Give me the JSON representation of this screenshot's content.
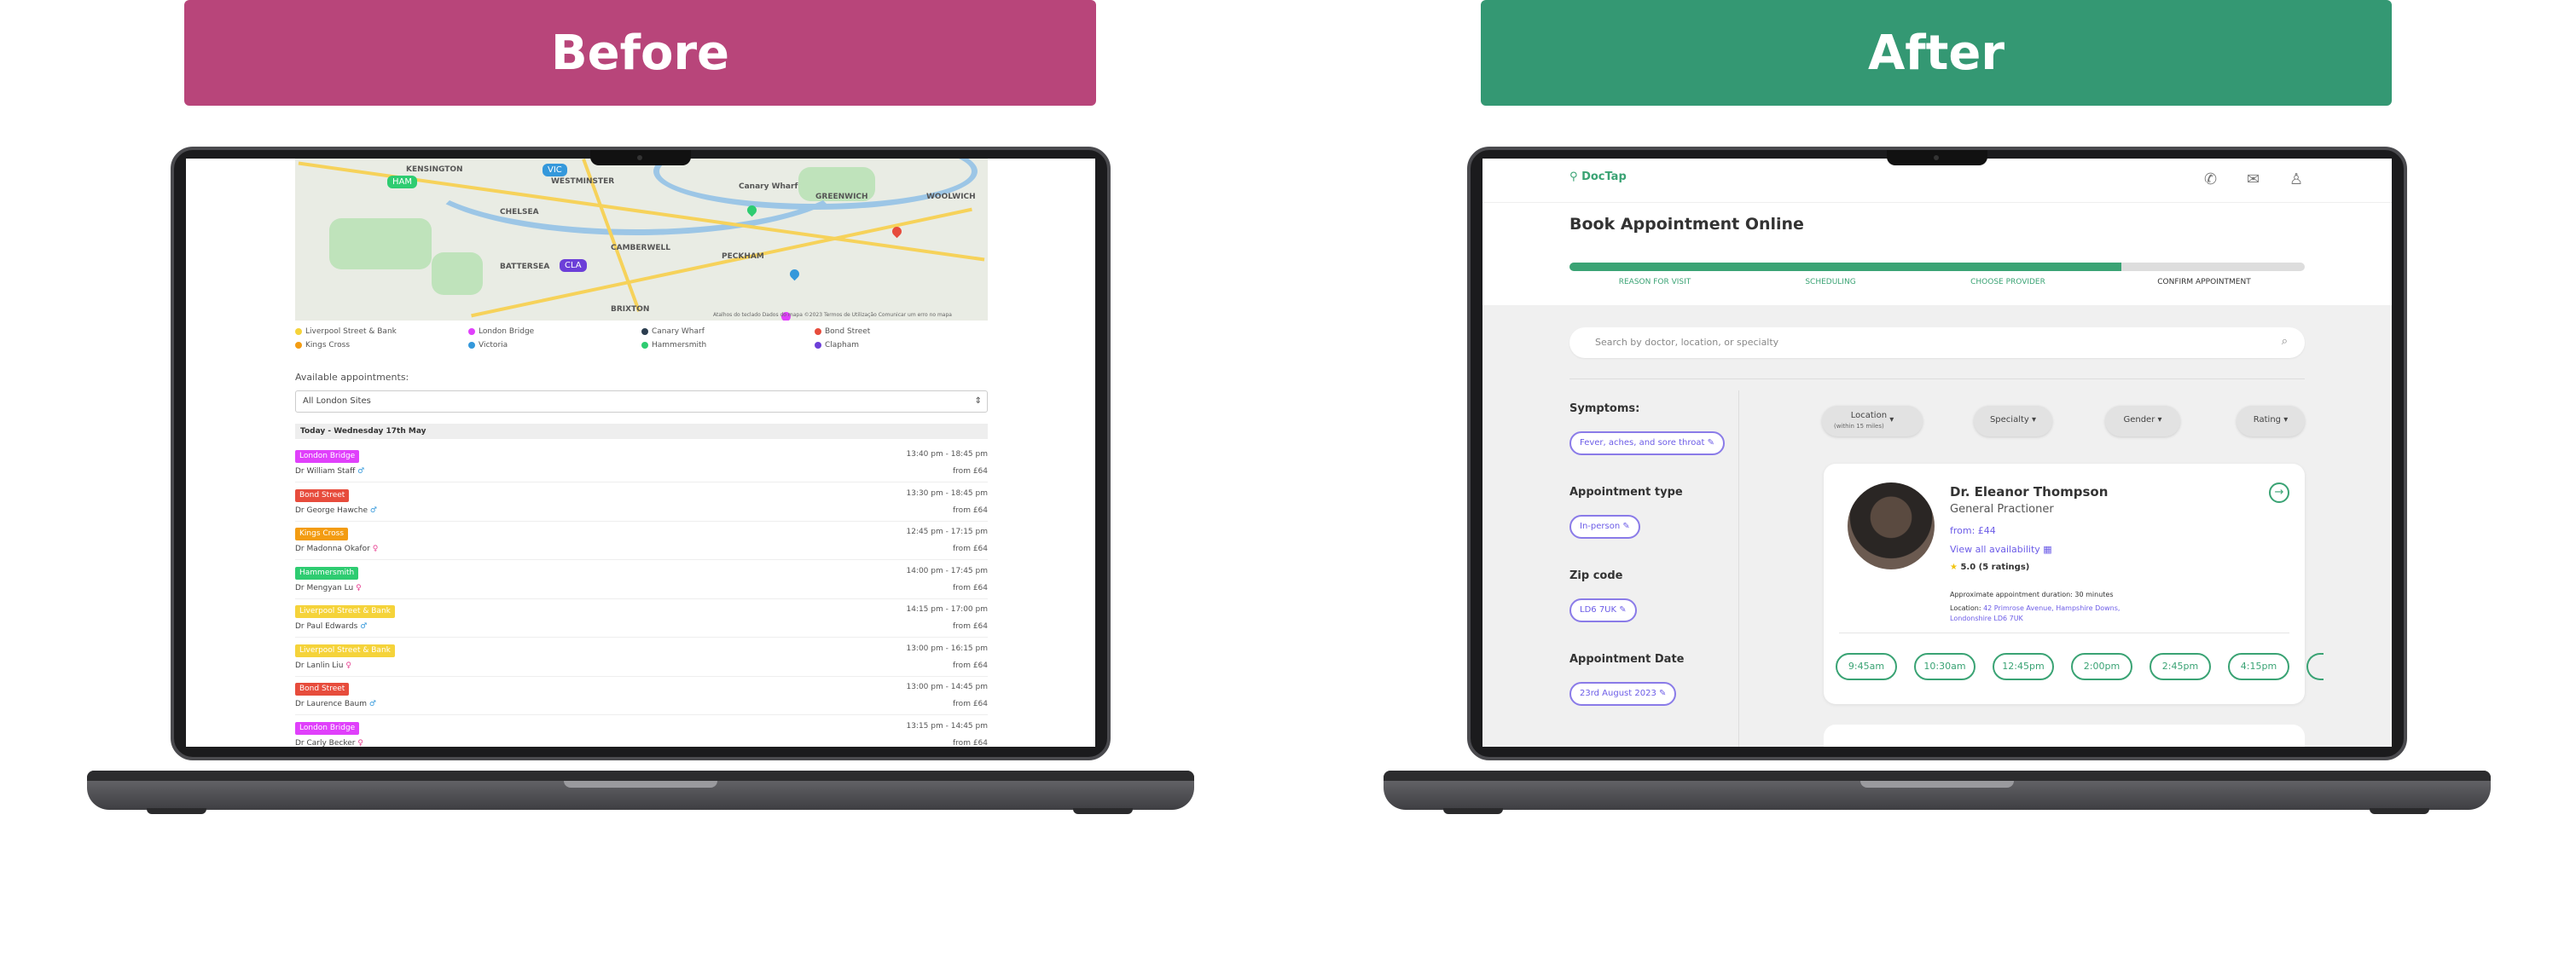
{
  "banners": {
    "before": "Before",
    "after": "After",
    "before_color": "#b8457a",
    "after_color": "#349873"
  },
  "before": {
    "map_labels": [
      "KENSINGTON",
      "WESTMINSTER",
      "CHELSEA",
      "BATTERSEA",
      "CAMBERWELL",
      "PECKHAM",
      "GREENWICH",
      "BRIXTON",
      "WOOLWICH",
      "Canary Wharf"
    ],
    "map_tags": [
      {
        "text": "HAM",
        "color": "#2ecc71"
      },
      {
        "text": "VIC",
        "color": "#3498db"
      },
      {
        "text": "CLA",
        "color": "#6c3fd8"
      }
    ],
    "map_footer": "Atalhos do teclado   Dados do mapa ©2023   Termos de Utilização   Comunicar um erro no mapa",
    "legend": [
      {
        "label": "Liverpool Street & Bank",
        "color": "#f5d33a"
      },
      {
        "label": "London Bridge",
        "color": "#e040fb"
      },
      {
        "label": "Canary Wharf",
        "color": "#2c3e50"
      },
      {
        "label": "Bond Street",
        "color": "#e74c3c"
      },
      {
        "label": "Kings Cross",
        "color": "#f39c12"
      },
      {
        "label": "Victoria",
        "color": "#3498db"
      },
      {
        "label": "Hammersmith",
        "color": "#2ecc71"
      },
      {
        "label": "Clapham",
        "color": "#6c3fd8"
      }
    ],
    "available_label": "Available appointments:",
    "select_value": "All London Sites",
    "day_header": "Today - Wednesday 17th May",
    "appointments": [
      {
        "site": "London Bridge",
        "color": "#e040fb",
        "doctor": "Dr William Staff",
        "time": "13:40 pm - 18:45 pm",
        "price": "from £64",
        "gender": "♂"
      },
      {
        "site": "Bond Street",
        "color": "#e74c3c",
        "doctor": "Dr George Hawche",
        "time": "13:30 pm - 18:45 pm",
        "price": "from £64",
        "gender": "♂"
      },
      {
        "site": "Kings Cross",
        "color": "#f39c12",
        "doctor": "Dr Madonna Okafor",
        "time": "12:45 pm - 17:15 pm",
        "price": "from £64",
        "gender": "♀"
      },
      {
        "site": "Hammersmith",
        "color": "#2ecc71",
        "doctor": "Dr Mengyan Lu",
        "time": "14:00 pm - 17:45 pm",
        "price": "from £64",
        "gender": "♀"
      },
      {
        "site": "Liverpool Street & Bank",
        "color": "#f5d33a",
        "doctor": "Dr Paul Edwards",
        "time": "14:15 pm - 17:00 pm",
        "price": "from £64",
        "gender": "♂"
      },
      {
        "site": "Liverpool Street & Bank",
        "color": "#f5d33a",
        "doctor": "Dr Lanlin Liu",
        "time": "13:00 pm - 16:15 pm",
        "price": "from £64",
        "gender": "♀"
      },
      {
        "site": "Bond Street",
        "color": "#e74c3c",
        "doctor": "Dr Laurence Baum",
        "time": "13:00 pm - 14:45 pm",
        "price": "from £64",
        "gender": "♂"
      },
      {
        "site": "London Bridge",
        "color": "#e040fb",
        "doctor": "Dr Carly Becker",
        "time": "13:15 pm - 14:45 pm",
        "price": "from £64",
        "gender": "♀"
      }
    ]
  },
  "after": {
    "logo": "DocTap",
    "title": "Book Appointment Online",
    "progress": 0.75,
    "steps": [
      "REASON FOR VISIT",
      "SCHEDULING",
      "CHOOSE PROVIDER",
      "CONFIRM APPOINTMENT"
    ],
    "search_placeholder": "Search by doctor, location, or specialty",
    "sidebar": {
      "symptoms_label": "Symptoms:",
      "symptoms_value": "Fever, aches, and sore throat",
      "type_label": "Appointment type",
      "type_value": "In-person",
      "zip_label": "Zip code",
      "zip_value": "LD6 7UK",
      "date_label": "Appointment Date",
      "date_value": "23rd August 2023"
    },
    "filters": [
      {
        "label": "Location",
        "sub": "(within 15 miles)"
      },
      {
        "label": "Specialty",
        "sub": ""
      },
      {
        "label": "Gender",
        "sub": ""
      },
      {
        "label": "Rating",
        "sub": ""
      }
    ],
    "doctor": {
      "name": "Dr. Eleanor Thompson",
      "specialty": "General Practioner",
      "from": "from: £44",
      "view": "View all availability",
      "rating": "5.0 (5 ratings)",
      "duration_label": "Approximate appointment duration:",
      "duration": "30 minutes",
      "location_label": "Location:",
      "location": "42 Primrose Avenue, Hampshire Downs, Londonshire LD6 7UK"
    },
    "slots": [
      "9:45am",
      "10:30am",
      "12:45pm",
      "2:00pm",
      "2:45pm",
      "4:15pm"
    ]
  }
}
